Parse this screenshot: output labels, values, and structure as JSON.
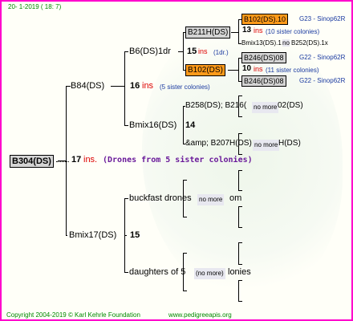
{
  "header": {
    "date": "20- 1-2019 ( 18: 7)"
  },
  "root": {
    "id": "B304(DS)",
    "ins_num": "17",
    "ins_label": "ins.",
    "note": "(Drones from 5 sister colonies)"
  },
  "dam": {
    "id": "B84(DS)",
    "ins_num": "16",
    "ins_label": "ins",
    "note": "(5 sister colonies)"
  },
  "sire": {
    "id": "Bmix17(DS)",
    "ins_num": "15"
  },
  "dam_dam": {
    "id": "B6(DS)1dr",
    "ins_num": "15",
    "ins_label": "ins",
    "note": "(1dr.)"
  },
  "dam_sire": {
    "id": "Bmix16(DS)",
    "ins_num": "14"
  },
  "sire_dam": {
    "label": "buckfast drones",
    "badge": "no more",
    "tail": "om"
  },
  "sire_sire": {
    "label": "daughters of 5",
    "badge": "(no more)",
    "tail": "lonies"
  },
  "g3": {
    "a1": "B211H(DS)",
    "a2": "B102(DS)",
    "b1": "B258(DS); B216(",
    "b1_badge": "no more",
    "b1_tail": "02(DS)",
    "b2": "&amp; B207H(DS)",
    "b2_badge": "no more",
    "b2_tail": "H(DS)"
  },
  "g4": {
    "r1_id": "B102(DS).10",
    "r1_note": "G23 - Sinop62R",
    "r2_num": "13",
    "r2_ins": "ins",
    "r2_note": "(10 sister colonies)",
    "r3": "Bmix13(DS).1",
    "r3_badge": "no",
    "r3_tail": "B252(DS).1x",
    "r4_id": "B246(DS)08",
    "r4_note": "G22 - Sinop62R",
    "r5_num": "10",
    "r5_ins": "ins",
    "r5_note": "(11 sister colonies)",
    "r6_id": "B246(DS)08",
    "r6_note": "G22 - Sinop62R"
  },
  "footer": {
    "copyright": "Copyright 2004-2019 © Karl Kehrle Foundation",
    "url": "www.pedigreeapis.org"
  },
  "colors": {
    "border": "#ff00cc",
    "orange": "#ff9a1a",
    "grey": "#d4d4d4",
    "ins_red": "#dd0000",
    "note_blue": "#1a3aa0",
    "footer_green": "#008800"
  }
}
